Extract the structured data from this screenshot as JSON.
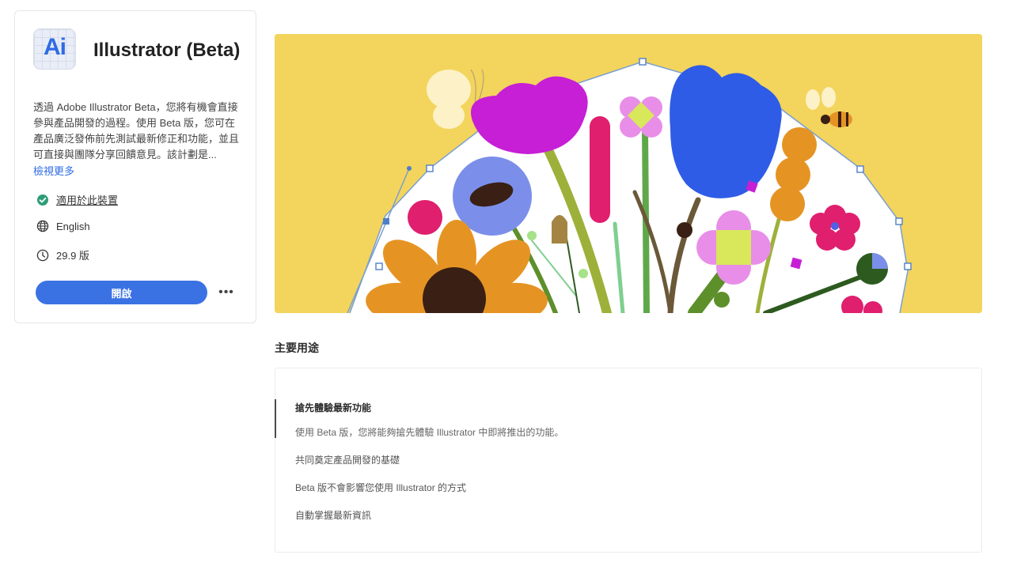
{
  "app": {
    "icon_text": "Ai",
    "title": "Illustrator (Beta)",
    "description": "透過 Adobe Illustrator Beta，您將有機會直接參與產品開發的過程。使用 Beta 版，您可在產品廣泛發佈前先測試最新修正和功能，並且可直接與團隊分享回饋意見。該計劃是...",
    "view_more": "檢視更多",
    "compat": "適用於此裝置",
    "language": "English",
    "version": "29.9 版",
    "open_button": "開啟",
    "more_button": "•••"
  },
  "icons": {
    "compat": "check-circle-icon",
    "language": "globe-icon",
    "version": "clock-icon",
    "more": "more-horizontal-icon"
  },
  "colors": {
    "accent": "#3b72e3",
    "hero_background": "#f3d45c",
    "check": "#2d9d78"
  },
  "main": {
    "section_title": "主要用途",
    "uses": [
      {
        "title": "搶先體驗最新功能",
        "detail": "使用 Beta 版，您將能夠搶先體驗 Illustrator 中即將推出的功能。"
      },
      {
        "title": "共同奠定產品開發的基礎"
      },
      {
        "title": "Beta 版不會影響您使用 Illustrator 的方式"
      },
      {
        "title": "自動掌握最新資訊"
      }
    ]
  }
}
